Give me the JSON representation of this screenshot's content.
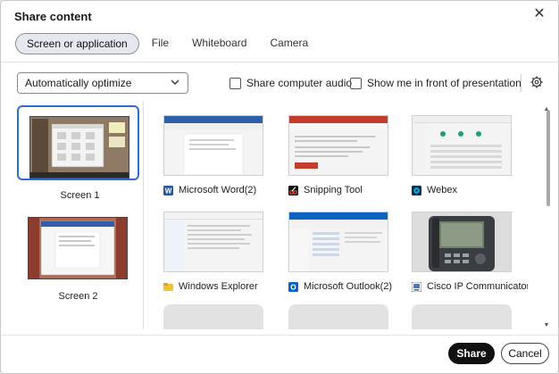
{
  "dialog": {
    "title": "Share content",
    "close_glyph": "✕"
  },
  "tabs": [
    {
      "label": "Screen or application",
      "active": true
    },
    {
      "label": "File",
      "active": false
    },
    {
      "label": "Whiteboard",
      "active": false
    },
    {
      "label": "Camera",
      "active": false
    }
  ],
  "optimize": {
    "selected": "Automatically optimize",
    "icon": "chevron-down-icon"
  },
  "options": {
    "share_audio": {
      "label": "Share computer audio",
      "checked": false
    },
    "show_me": {
      "label": "Show me in front of presentation",
      "checked": false
    },
    "settings_icon": "gear-icon"
  },
  "screens": [
    {
      "label": "Screen 1",
      "selected": true
    },
    {
      "label": "Screen 2",
      "selected": false
    }
  ],
  "apps": [
    {
      "name": "Microsoft Word(2)",
      "icon": "word-icon"
    },
    {
      "name": "Snipping Tool",
      "icon": "snipping-tool-icon"
    },
    {
      "name": "Webex",
      "icon": "webex-icon"
    },
    {
      "name": "Windows Explorer",
      "icon": "folder-icon"
    },
    {
      "name": "Microsoft Outlook(2)",
      "icon": "outlook-icon"
    },
    {
      "name": "Cisco IP Communicator",
      "icon": "phone-icon"
    }
  ],
  "footer": {
    "share_label": "Share",
    "cancel_label": "Cancel"
  },
  "colors": {
    "accent": "#2a6fcf",
    "primary_button": "#111111",
    "tab_active_bg": "#e5e8ee"
  }
}
